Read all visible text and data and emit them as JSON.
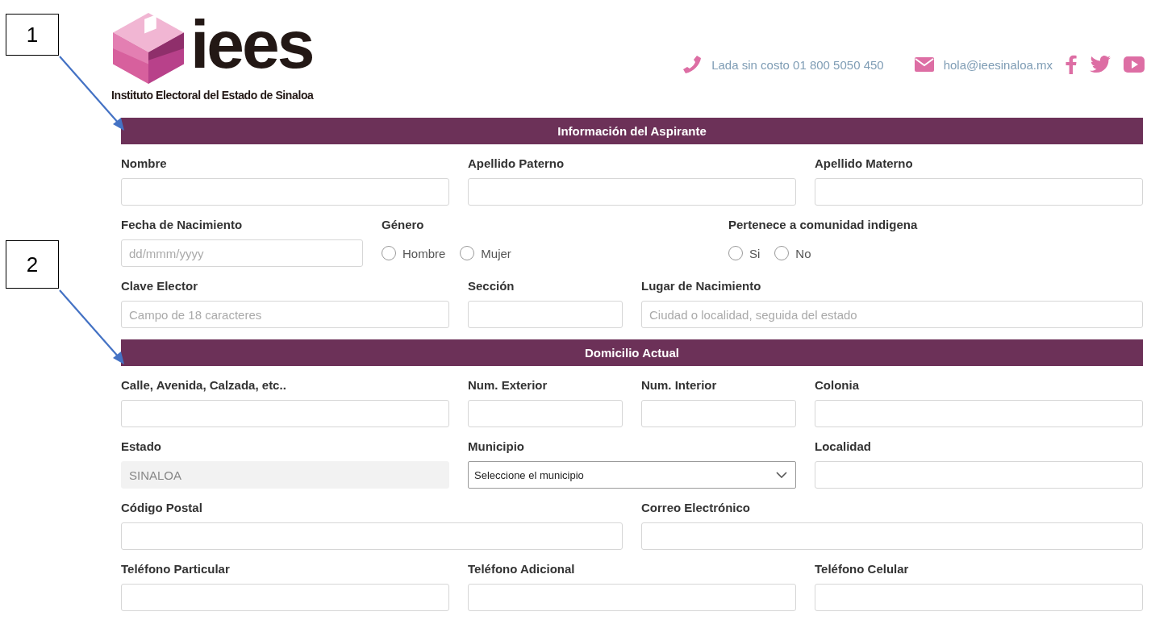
{
  "callouts": [
    {
      "label": "1"
    },
    {
      "label": "2"
    }
  ],
  "header": {
    "logo_text": "iees",
    "logo_subtitle": "Instituto Electoral del Estado de Sinaloa",
    "phone": "Lada sin costo 01 800 5050 450",
    "email": "hola@ieesinaloa.mx"
  },
  "sections": [
    {
      "title": "Información del Aspirante",
      "rows": [
        {
          "fields": [
            {
              "kind": "text",
              "label": "Nombre"
            },
            {
              "kind": "text",
              "label": "Apellido Paterno"
            },
            {
              "kind": "text",
              "label": "Apellido Materno"
            }
          ]
        },
        {
          "fields": [
            {
              "kind": "text",
              "label": "Fecha de Nacimiento",
              "placeholder": "dd/mmm/yyyy"
            },
            {
              "kind": "radio",
              "label": "Género",
              "options": [
                {
                  "label": "Hombre",
                  "selected": false
                },
                {
                  "label": "Mujer",
                  "selected": false
                }
              ]
            },
            {
              "kind": "radio",
              "label": "Pertenece a comunidad indigena",
              "options": [
                {
                  "label": "Si",
                  "selected": false
                },
                {
                  "label": "No",
                  "selected": false
                }
              ]
            }
          ]
        },
        {
          "fields": [
            {
              "kind": "text",
              "label": "Clave Elector",
              "placeholder": "Campo de 18 caracteres"
            },
            {
              "kind": "text",
              "label": "Sección"
            },
            {
              "kind": "text",
              "label": "Lugar de Nacimiento",
              "placeholder": "Ciudad o localidad, seguida del estado"
            }
          ]
        }
      ]
    },
    {
      "title": "Domicilio Actual",
      "rows": [
        {
          "fields": [
            {
              "kind": "text",
              "label": "Calle, Avenida, Calzada, etc.."
            },
            {
              "kind": "text",
              "label": "Num. Exterior"
            },
            {
              "kind": "text",
              "label": "Num. Interior"
            },
            {
              "kind": "text",
              "label": "Colonia"
            }
          ]
        },
        {
          "fields": [
            {
              "kind": "text",
              "label": "Estado",
              "value": "SINALOA",
              "disabled": true
            },
            {
              "kind": "select",
              "label": "Municipio",
              "value": "Seleccione el municipio"
            },
            {
              "kind": "text",
              "label": "Localidad"
            }
          ]
        },
        {
          "fields": [
            {
              "kind": "text",
              "label": "Código Postal"
            },
            {
              "kind": "text",
              "label": "Correo Electrónico"
            }
          ]
        },
        {
          "fields": [
            {
              "kind": "text",
              "label": "Teléfono Particular"
            },
            {
              "kind": "text",
              "label": "Teléfono Adicional"
            },
            {
              "kind": "text",
              "label": "Teléfono Celular"
            }
          ]
        }
      ]
    }
  ]
}
